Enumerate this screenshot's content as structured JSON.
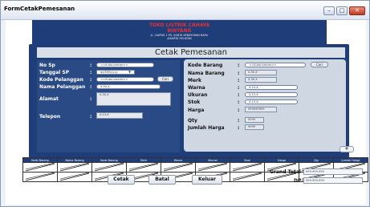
{
  "window": {
    "title": "FormCetakPemesanan",
    "min": "–",
    "max": "□",
    "close": "✕"
  },
  "store": {
    "name_line1": "TOKO LISTRIK CAHAYA",
    "name_line2": "BINTANG",
    "address_line1": "JL. CIAPNG 1 PS. SANTA KEBAYORAN BARU",
    "address_line2": "JAKARTA SELATAN"
  },
  "heading": "Cetak Pemesanan",
  "left_form": {
    "no_sp": {
      "label": "No Sp",
      "value": "<<Autonumber>>"
    },
    "tanggal_sp": {
      "label": "Tanggal SP",
      "value": "dd/MM/yyyy"
    },
    "kode_pelanggan": {
      "label": "Kode Pelanggan",
      "value": "<<Autonumber>>",
      "button": "Cari"
    },
    "nama_pelanggan": {
      "label": "Nama Pelanggan",
      "value": "X-50-X"
    },
    "alamat": {
      "label": "Alamat",
      "value": "X-50-X"
    },
    "telepon": {
      "label": "Telepon",
      "value": "X-13-X"
    }
  },
  "right_form": {
    "kode_barang": {
      "label": "Kode Barang",
      "value": "<<Autonumber>>",
      "button": "Cari"
    },
    "nama_barang": {
      "label": "Nama Barang",
      "value": "X-50-X"
    },
    "merk": {
      "label": "Merk",
      "value": "X-30-X"
    },
    "warna": {
      "label": "Warna",
      "value": "X-10-X"
    },
    "ukuran": {
      "label": "Ukuran",
      "value": "X-15-X"
    },
    "stok": {
      "label": "Stok",
      "value": "X-13-X"
    },
    "harga": {
      "label": "Harga",
      "value": "999999999"
    },
    "qty": {
      "label": "Qty",
      "value": "9999"
    },
    "jumlah_harga": {
      "label": "Jumlah Harga",
      "value": "9999"
    }
  },
  "colon": ":",
  "add_button": "+",
  "grid": {
    "headers": [
      "Kode Barang",
      "Nama Barang",
      "Kode Barang",
      "Merk",
      "Warna",
      "Ukuran",
      "Stok",
      "Harga",
      "Qty",
      "Jumlah Harga"
    ]
  },
  "totals": {
    "grand_total": {
      "label": "Grand Total",
      "value": "999.999.999"
    },
    "dp": {
      "label": "DP",
      "value": "999.999.999"
    }
  },
  "actions": {
    "cetak": "Cetak",
    "batal": "Batal",
    "keluar": "Keluar"
  }
}
